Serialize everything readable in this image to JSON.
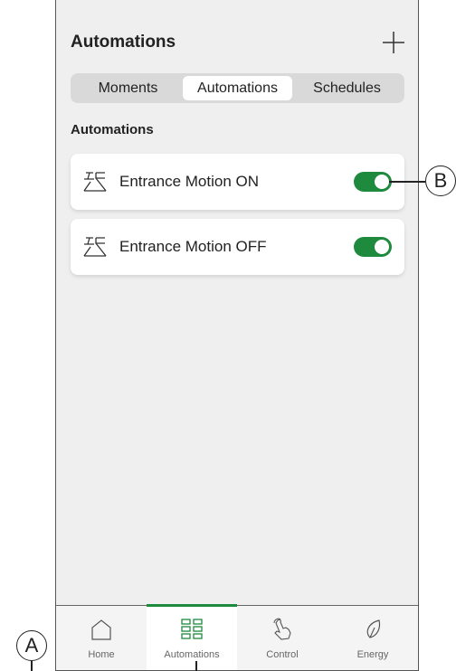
{
  "header": {
    "title": "Automations",
    "add_icon": "plus-icon"
  },
  "segments": [
    {
      "label": "Moments",
      "active": false
    },
    {
      "label": "Automations",
      "active": true
    },
    {
      "label": "Schedules",
      "active": false
    }
  ],
  "section_label": "Automations",
  "automations": [
    {
      "label": "Entrance Motion ON",
      "enabled": true,
      "icon": "motion-sensor-icon"
    },
    {
      "label": "Entrance Motion OFF",
      "enabled": true,
      "icon": "motion-sensor-icon"
    }
  ],
  "tabbar": [
    {
      "label": "Home",
      "icon": "home-icon",
      "active": false
    },
    {
      "label": "Automations",
      "icon": "grid-icon",
      "active": true
    },
    {
      "label": "Control",
      "icon": "hand-pointer-icon",
      "active": false
    },
    {
      "label": "Energy",
      "icon": "leaf-icon",
      "active": false
    }
  ],
  "callouts": {
    "a": "A",
    "b": "B"
  },
  "colors": {
    "accent": "#1e8a3e",
    "background": "#efefef",
    "card": "#ffffff"
  }
}
